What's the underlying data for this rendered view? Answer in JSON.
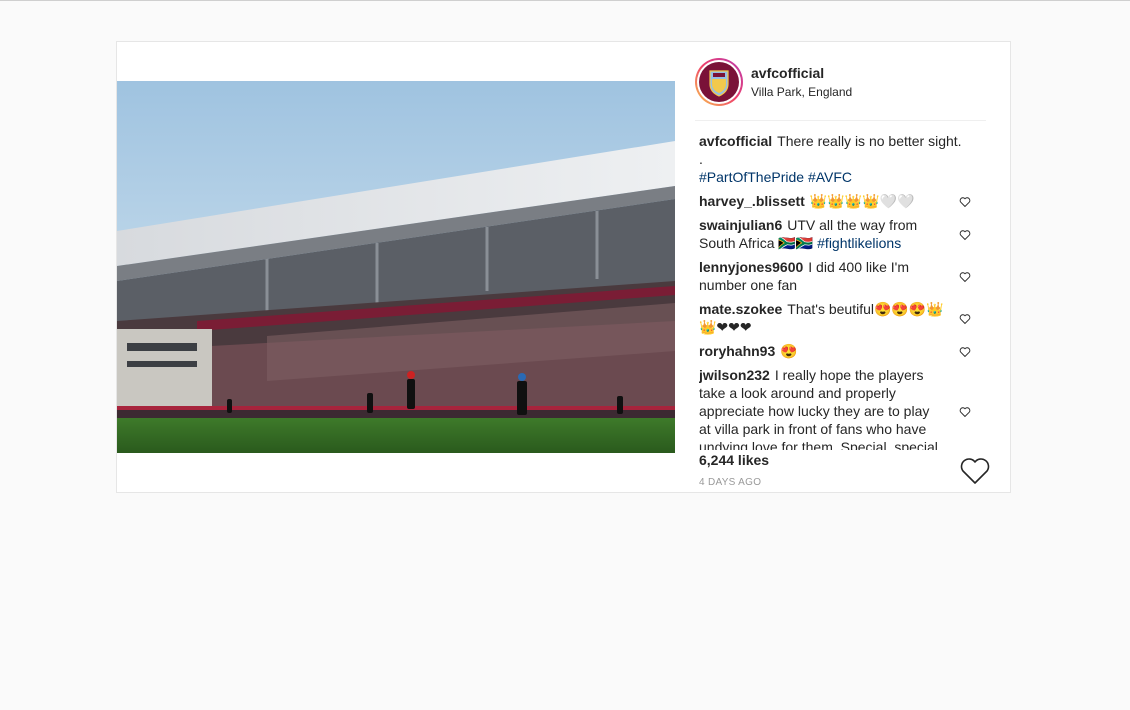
{
  "post": {
    "username": "avfcofficial",
    "location": "Villa Park, England",
    "likes": "6,244 likes",
    "time": "4 DAYS AGO"
  },
  "caption": {
    "username": "avfcofficial",
    "text": "There really is no better sight.",
    "dot": ".",
    "hashtag1": "#PartOfThePride",
    "hashtag2": "#AVFC"
  },
  "comments": [
    {
      "username": "harvey_.blissett",
      "text": "👑👑👑👑🤍🤍"
    },
    {
      "username": "swainjulian6",
      "text": "UTV all the way from South Africa 🇿🇦🇿🇦",
      "hashtag": "#fightlikelions"
    },
    {
      "username": "lennyjones9600",
      "text": "I did 400 like I'm number one fan"
    },
    {
      "username": "mate.szokee",
      "text": "That's beutiful😍😍😍👑👑❤❤❤"
    },
    {
      "username": "roryhahn93",
      "text": "😍"
    },
    {
      "username": "jwilson232",
      "text": "I really hope the players take a look around and properly appreciate how lucky they are to play at villa park in front of fans who have undying love for them. Special, special club!"
    }
  ],
  "icons": {
    "avatar": "avfc-crest-icon",
    "comment_like": "heart-outline-icon",
    "post_like": "heart-outline-icon"
  },
  "colors": {
    "link": "#003569",
    "text": "#262626",
    "muted": "#999999",
    "avatar_ring": "#ee3f6b"
  }
}
